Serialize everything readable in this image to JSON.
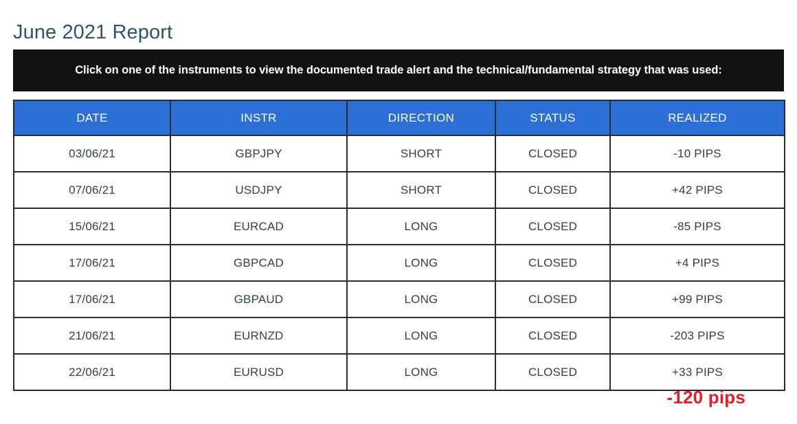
{
  "page": {
    "title": "June 2021 Report"
  },
  "notice": {
    "text": "Click on one of the instruments to view the documented trade alert and the technical/fundamental strategy that was used:"
  },
  "table": {
    "columns": [
      {
        "key": "date",
        "label": "DATE"
      },
      {
        "key": "instr",
        "label": "INSTR"
      },
      {
        "key": "direction",
        "label": "DIRECTION"
      },
      {
        "key": "status",
        "label": "STATUS"
      },
      {
        "key": "realized",
        "label": "REALIZED"
      }
    ],
    "rows": [
      {
        "date": "03/06/21",
        "instr": "GBPJPY",
        "direction": "SHORT",
        "status": "CLOSED",
        "realized": "-10 PIPS",
        "sign": "neg"
      },
      {
        "date": "07/06/21",
        "instr": "USDJPY",
        "direction": "SHORT",
        "status": "CLOSED",
        "realized": "+42 PIPS",
        "sign": "pos"
      },
      {
        "date": "15/06/21",
        "instr": "EURCAD",
        "direction": "LONG",
        "status": "CLOSED",
        "realized": "-85 PIPS",
        "sign": "neg"
      },
      {
        "date": "17/06/21",
        "instr": "GBPCAD",
        "direction": "LONG",
        "status": "CLOSED",
        "realized": "+4 PIPS",
        "sign": "pos"
      },
      {
        "date": "17/06/21",
        "instr": "GBPAUD",
        "direction": "LONG",
        "status": "CLOSED",
        "realized": "+99 PIPS",
        "sign": "pos"
      },
      {
        "date": "21/06/21",
        "instr": "EURNZD",
        "direction": "LONG",
        "status": "CLOSED",
        "realized": "-203 PIPS",
        "sign": "neg"
      },
      {
        "date": "22/06/21",
        "instr": "EURUSD",
        "direction": "LONG",
        "status": "CLOSED",
        "realized": "+33 PIPS",
        "sign": "pos"
      }
    ]
  },
  "total": {
    "label": "-120 pips"
  },
  "colors": {
    "title": "#31536a",
    "header_blue": "#2c6fd6",
    "notice_background": "#121212",
    "border": "#2b2b2b",
    "positive": "#2f8b4f",
    "negative": "#f59a23",
    "total_red": "#ea1b26",
    "cell_text": "#33404d"
  }
}
